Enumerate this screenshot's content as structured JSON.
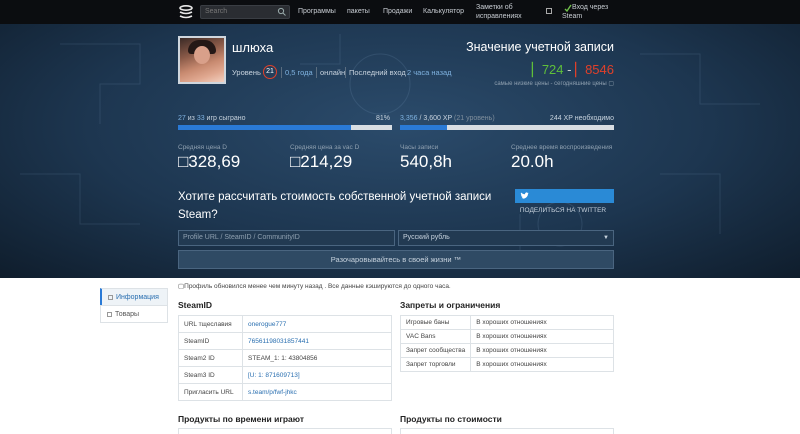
{
  "nav": {
    "search_placeholder": "Search",
    "links": [
      "Программы",
      "пакеты",
      "Продажи",
      "Калькулятор",
      "Заметки об исправлениях"
    ],
    "login": "Вход через Steam"
  },
  "profile": {
    "username": "шлюха",
    "level_label": "Уровень",
    "level": "21",
    "years": "0,5 года",
    "status": "онлайн",
    "last_login_label": "Последний вход",
    "last_login": "2 часа назад"
  },
  "account_value": {
    "title": "Значение учетной записи",
    "low": "▏724",
    "dash": " - ",
    "high": "▏8546",
    "note": "самые низкие цены - сегодняшние цены ▢"
  },
  "progress": {
    "games_played": "27",
    "games_of": " из ",
    "games_total": "33",
    "games_suffix": " игр сыграно",
    "games_percent": "81%",
    "games_fraction": 0.81,
    "xp_current": "3,356",
    "xp_sep": " / ",
    "xp_target": "3,600 XP",
    "xp_note": " (21 уровень)",
    "xp_needed": "244 XP необходимо",
    "xp_fraction": 0.22
  },
  "stats": [
    {
      "label": "Средняя цена D",
      "value": "□328,69"
    },
    {
      "label": "Средняя цена за vac D",
      "value": "□214,29"
    },
    {
      "label": "Часы записи",
      "value": "540,8h"
    },
    {
      "label": "Среднее время воспроизведения",
      "value": "20.0h"
    }
  ],
  "calculator": {
    "title": "Хотите рассчитать стоимость собственной учетной записи Steam?",
    "share_label": "ПОДЕЛИТЬСЯ НА TWITTER",
    "input_placeholder": "Profile URL / SteamID / CommunityID",
    "currency": "Русский рубль",
    "submit": "Разочаровывайтесь в своей жизни ™"
  },
  "refresh_note": "▢Профиль обновился менее чем минуту назад . Все данные кэшируются до одного часа.",
  "sidebar": {
    "items": [
      {
        "label": "Информация"
      },
      {
        "label": "Товары"
      }
    ]
  },
  "steamid": {
    "title": "SteamID",
    "rows": [
      {
        "key": "URL тщеславия",
        "value": "onerogue777"
      },
      {
        "key": "SteamID",
        "value": "76561198031857441"
      },
      {
        "key": "Steam2 ID",
        "value": "STEAM_1: 1: 43804856"
      },
      {
        "key": "Steam3 ID",
        "value": "[U: 1: 871609713]"
      },
      {
        "key": "Пригласить URL",
        "value": "s.team/p/fwf-jhkc"
      }
    ]
  },
  "bans": {
    "title": "Запреты и ограничения",
    "rows": [
      {
        "key": "Игровые баны",
        "value": "В хороших отношениях"
      },
      {
        "key": "VAC Bans",
        "value": "В хороших отношениях"
      },
      {
        "key": "Запрет сообщества",
        "value": "В хороших отношениях"
      },
      {
        "key": "Запрет торговли",
        "value": "В хороших отношениях"
      }
    ]
  },
  "products_time": {
    "title": "Продукты по времени играют"
  },
  "products_cost": {
    "title": "Продукты по стоимости"
  },
  "colors": {
    "accent": "#2a7ad6",
    "good": "#5fbf3a",
    "bad": "#e0402a"
  }
}
